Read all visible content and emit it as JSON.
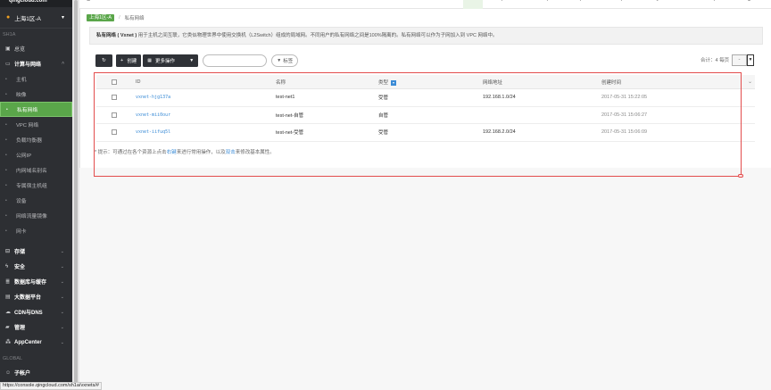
{
  "sidebar": {
    "brand": "qingcloud.com",
    "zone": "上海1区-A",
    "region_label": "SH1A",
    "overview": "总览",
    "compute_group": "计算与网络",
    "compute_items": [
      "主机",
      "映像",
      "私有网络",
      "VPC 网络",
      "负载均衡器",
      "公网IP",
      "内网域名别名",
      "专属宿主机组",
      "设备",
      "网络流量镜像",
      "网卡"
    ],
    "active_item": "私有网络",
    "groups": [
      "存储",
      "安全",
      "数据库与缓存",
      "大数据平台",
      "CDN与DNS",
      "管理",
      "AppCenter"
    ],
    "global_label": "GLOBAL",
    "account": "子帐户"
  },
  "status_url": "https://console.qingcloud.com/sh1a/vxnets/#",
  "breadcrumb": {
    "zone": "上海1区-A",
    "current": "私有网络"
  },
  "info": {
    "title": "私有网络 ( Vxnet )",
    "text": "用于主机之间互联，它类似物理世界中使用交换机（L2Switch）组成的局域网。不同用户的私有网络之间是100%隔离的。私有网络可以作为子网加入到 VPC 网络中。"
  },
  "toolbar": {
    "create": "创建",
    "more": "更多操作",
    "search_placeholder": "",
    "tag": "标签"
  },
  "pagination": {
    "total": "合计：4  每页",
    "page_size": "-"
  },
  "table": {
    "headers": {
      "id": "ID",
      "name": "名称",
      "type": "类型",
      "address": "网络地址",
      "created": "创建时间"
    },
    "rows": [
      {
        "id": "vxnet-hjg137a",
        "name": "test-net1",
        "type": "受管",
        "address": "192.168.1.0/24",
        "created": "2017-05-31 15:22:05"
      },
      {
        "id": "vxnet-mii0our",
        "name": "test-net-自管",
        "type": "自管",
        "address": "",
        "created": "2017-05-31 15:06:27"
      },
      {
        "id": "vxnet-iifuq5l",
        "name": "test-net-受管",
        "type": "受管",
        "address": "192.168.2.0/24",
        "created": "2017-05-31 15:06:09"
      }
    ]
  },
  "tip": {
    "prefix": "* 提示：可通过在各个资源上点击",
    "link1": "右键",
    "middle": "来进行常用操作，以及",
    "link2": "双击",
    "suffix": "来修改基本属性。"
  },
  "colors": {
    "accent": "#5aa64a",
    "link": "#3a8bd6",
    "sidebar": "#2d2f33",
    "highlight": "#e34d4d"
  }
}
